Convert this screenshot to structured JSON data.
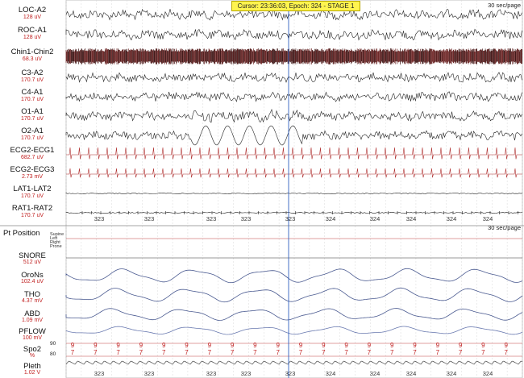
{
  "cursor": {
    "text": "Cursor: 23:36:03, Epoch: 324 - STAGE 1"
  },
  "page_rate": {
    "top": "30 sec/page",
    "middle": "30 sec/page"
  },
  "channels": [
    {
      "name": "LOC-A2",
      "scale": "128 uV"
    },
    {
      "name": "ROC-A1",
      "scale": "128 uV"
    },
    {
      "name": "Chin1-Chin2",
      "scale": "68.3 uV"
    },
    {
      "name": "C3-A2",
      "scale": "170.7 uV"
    },
    {
      "name": "C4-A1",
      "scale": "170.7 uV"
    },
    {
      "name": "O1-A1",
      "scale": "170.7 uV"
    },
    {
      "name": "O2-A1",
      "scale": "170.7 uV"
    },
    {
      "name": "ECG2-ECG1",
      "scale": "682.7 uV"
    },
    {
      "name": "ECG2-ECG3",
      "scale": "2.73 mV"
    },
    {
      "name": "LAT1-LAT2",
      "scale": "170.7 uV"
    },
    {
      "name": "RAT1-RAT2",
      "scale": "170.7 uV"
    }
  ],
  "epoch_ticks": [
    "323",
    "323",
    "323",
    "323",
    "323",
    "324",
    "324",
    "324",
    "324",
    "324"
  ],
  "resp_channels": [
    {
      "name": "Pt Position",
      "scale": ""
    },
    {
      "name": "SNORE",
      "scale": "512 uV"
    },
    {
      "name": "OroNs",
      "scale": "102.4 uV"
    },
    {
      "name": "THO",
      "scale": "4.37 mV"
    },
    {
      "name": "ABD",
      "scale": "1.09 mV"
    },
    {
      "name": "PFLOW",
      "scale": "100 mV"
    },
    {
      "name": "Spo2",
      "scale": "%"
    },
    {
      "name": "Pleth",
      "scale": "1.02 V"
    }
  ],
  "position_options": [
    "Supine",
    "Left",
    "Right",
    "Prone"
  ],
  "spo2": {
    "axis_top": "90",
    "axis_bottom": "80",
    "digit_top": "9",
    "digit_bottom": "7",
    "count": 20
  }
}
